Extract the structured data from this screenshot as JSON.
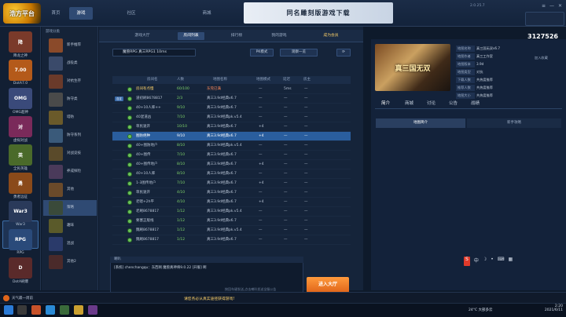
{
  "app": {
    "logo": "浩方平台",
    "version": "2.0.25.7",
    "coins": "3127526"
  },
  "nav": [
    "首页",
    "游戏",
    "",
    "社区",
    "",
    "",
    "商城"
  ],
  "banner": "同名雕刻版游戏下载",
  "sidebar": [
    {
      "label": "降龙之神",
      "color": "#7a3a2a",
      "icon": "降"
    },
    {
      "label": "DotA7.0",
      "color": "#b45a1a",
      "icon": "7.00"
    },
    {
      "label": "OMG超神",
      "color": "#3a4a7a",
      "icon": "OMG"
    },
    {
      "label": "虚拟对战",
      "color": "#7a2a5a",
      "icon": "对"
    },
    {
      "label": "全民英雄",
      "color": "#4a6a2a",
      "icon": "英"
    },
    {
      "label": "勇者远征",
      "color": "#8a4a1a",
      "icon": "勇"
    },
    {
      "label": "War3",
      "color": "#2a3a5a",
      "icon": "War3"
    },
    {
      "label": "RPG",
      "color": "#2a4a7a",
      "icon": "RPG"
    },
    {
      "label": "DotA刷爆",
      "color": "#5a2a2a",
      "icon": "D"
    }
  ],
  "catpanel_title": "游戏分类",
  "categories": [
    {
      "label": "新手推荐",
      "color": "#8a4a2a"
    },
    {
      "label": "战役类",
      "color": "#3a4a6a"
    },
    {
      "label": "对抗生存",
      "color": "#6a3a2a"
    },
    {
      "label": "防守类",
      "color": "#4a4a4a"
    },
    {
      "label": "塔防",
      "color": "#6a5a2a"
    },
    {
      "label": "防守系列",
      "color": "#3a5a7a"
    },
    {
      "label": "对战竞技",
      "color": "#5a4a2a"
    },
    {
      "label": "养成探险",
      "color": "#4a3a5a"
    },
    {
      "label": "其他",
      "color": "#6a4a2a"
    },
    {
      "label": "策略",
      "color": "#3a4a3a"
    },
    {
      "label": "趣味",
      "color": "#5a5a2a"
    },
    {
      "label": "混战",
      "color": "#2a3a6a"
    },
    {
      "label": "其他2",
      "color": "#4a2a2a"
    }
  ],
  "room": {
    "tabs": [
      "游戏大厅",
      "房间列表",
      "排行榜",
      "我的游戏",
      "成为会员"
    ],
    "select": "魔兽RPG 真三RPG1 10ms",
    "buttons": [
      "PK模式",
      "观察一览",
      "刷新"
    ]
  },
  "table": {
    "headers": [
      "房间名",
      "人数",
      "地图名称",
      "地图模式",
      "延迟",
      "房主"
    ],
    "rows": [
      {
        "tag": "",
        "name": "房间有点慢",
        "count": "60/100",
        "map": "东莞已满",
        "mode": "—",
        "ping": "5ms",
        "host": "—",
        "sel": false
      },
      {
        "tag": "自定",
        "name": "道初刷8678817",
        "count": "2/3",
        "map": "真三3.9d经典v6.7",
        "mode": "—",
        "ping": "—",
        "host": "—",
        "sel": false
      },
      {
        "tag": "",
        "name": "40+10人库++",
        "count": "9/10",
        "map": "真三3.9d经典v6.7",
        "mode": "—",
        "ping": "—",
        "host": "—",
        "sel": false
      },
      {
        "tag": "",
        "name": "40混道凶",
        "count": "7/10",
        "map": "真三3.9d经典pk.v5.4",
        "mode": "—",
        "ping": "—",
        "host": "—",
        "sel": false
      },
      {
        "tag": "",
        "name": "草民速开",
        "count": "10/10",
        "map": "真三3.9d经典v6.7",
        "mode": "+4",
        "ping": "—",
        "host": "—",
        "sel": false
      },
      {
        "tag": "",
        "name": "图防绝种",
        "count": "9/10",
        "map": "真三3.9d经典v6.7",
        "mode": "+4",
        "ping": "—",
        "host": "—",
        "sel": true
      },
      {
        "tag": "",
        "name": "40+图防地户",
        "count": "8/10",
        "map": "真三3.9d经典pk.v5.4",
        "mode": "—",
        "ping": "—",
        "host": "—",
        "sel": false
      },
      {
        "tag": "",
        "name": "40+图传",
        "count": "7/10",
        "map": "真三3.9d经典v6.7",
        "mode": "—",
        "ping": "—",
        "host": "—",
        "sel": false
      },
      {
        "tag": "",
        "name": "40+图传地户",
        "count": "8/10",
        "map": "真三3.9d经典v6.7",
        "mode": "+4",
        "ping": "—",
        "host": "—",
        "sel": false
      },
      {
        "tag": "",
        "name": "40+10人库",
        "count": "8/10",
        "map": "真三3.9d经典v6.7",
        "mode": "—",
        "ping": "—",
        "host": "—",
        "sel": false
      },
      {
        "tag": "",
        "name": "1-3图传地户",
        "count": "7/10",
        "map": "真三3.9d经典v6.7",
        "mode": "+4",
        "ping": "—",
        "host": "—",
        "sel": false
      },
      {
        "tag": "",
        "name": "草民速开",
        "count": "4/10",
        "map": "真三3.9d经典v6.7",
        "mode": "—",
        "ping": "—",
        "host": "—",
        "sel": false
      },
      {
        "tag": "",
        "name": "老嗯+2h平",
        "count": "4/10",
        "map": "真三3.9d经典v6.7",
        "mode": "+4",
        "ping": "—",
        "host": "—",
        "sel": false
      },
      {
        "tag": "",
        "name": "老刷8678817",
        "count": "1/12",
        "map": "真三3.9d经典pk.v5.4",
        "mode": "—",
        "ping": "—",
        "host": "—",
        "sel": false
      },
      {
        "tag": "",
        "name": "要塞正版线",
        "count": "1/12",
        "map": "真三3.9d经典v6.7",
        "mode": "—",
        "ping": "—",
        "host": "—",
        "sel": false
      },
      {
        "tag": "",
        "name": "魏刷8678817",
        "count": "1/12",
        "map": "真三3.9d经典pk.v5.4",
        "mode": "—",
        "ping": "—",
        "host": "—",
        "sel": false
      },
      {
        "tag": "",
        "name": "魏刷8678817",
        "count": "1/12",
        "map": "真三3.9d经典v6.7",
        "mode": "—",
        "ping": "—",
        "host": "—",
        "sel": false
      }
    ]
  },
  "chat": {
    "title": "喇叭",
    "message": "[系统] chenchangqu：东西网 魔兽真神将9.0.22 [开服] 啊",
    "input_hint": "按回车键发送,点击喇叭发送全服公告",
    "enter": "进入大厅"
  },
  "right": {
    "cover": "真三国无双",
    "info": [
      {
        "k": "地图名称",
        "v": "真三国无双v6.7"
      },
      {
        "k": "地图作者",
        "v": "真三工作室"
      },
      {
        "k": "地图版本",
        "v": "3.9d"
      },
      {
        "k": "地图类型",
        "v": "对抗"
      },
      {
        "k": "下载人数",
        "v": "共热度推荐"
      },
      {
        "k": "推荐人数",
        "v": "共热度推荐"
      },
      {
        "k": "地图大小",
        "v": "共热度推荐"
      }
    ],
    "info_link": "加入收藏",
    "tabs": [
      "简介",
      "商城",
      "讨论",
      "公告",
      "战绩"
    ],
    "subtabs": [
      "地图简介",
      "新手攻略"
    ]
  },
  "notice": "请您务必从真实途径获得游戏!",
  "taskbar": {
    "weather": "24°C 大部多云",
    "time": "2:20",
    "date": "2021/6/11",
    "leftlabel": "天气最一周前"
  }
}
